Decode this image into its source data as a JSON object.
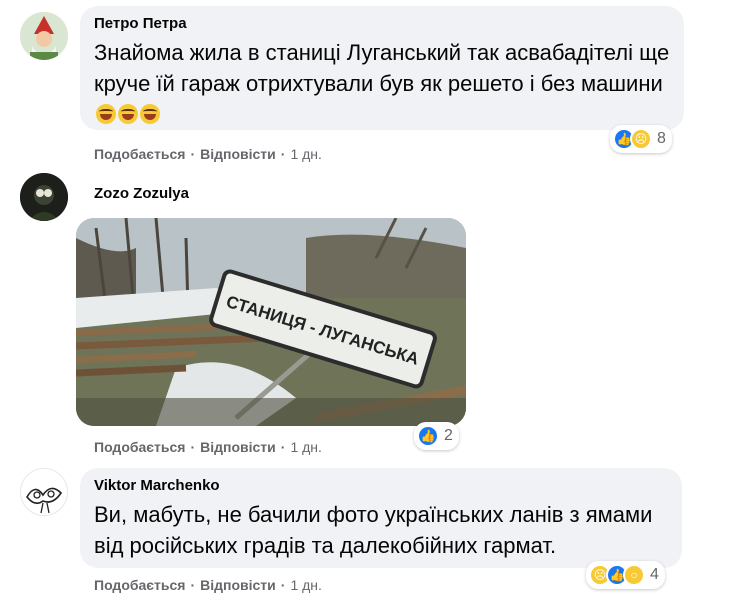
{
  "comments": [
    {
      "author": "Петро Петра",
      "text": "Знайома жила в станиці Луганський так асвабадітелі ще круче їй гараж отрихтували був як решето і без машини",
      "emoji": [
        "laughing-tears-emoji",
        "laughing-tears-emoji",
        "laughing-tears-emoji"
      ],
      "reactions": [
        "like",
        "sad"
      ],
      "reaction_count": "8",
      "like_label": "Подобається",
      "reply_label": "Відповісти",
      "time": "1 дн."
    },
    {
      "author": "Zozo Zozulya",
      "photo_sign_text": "СТАНИЦЯ - ЛУГАНСЬКА",
      "reactions": [
        "like"
      ],
      "reaction_count": "2",
      "like_label": "Подобається",
      "reply_label": "Відповісти",
      "time": "1 дн."
    },
    {
      "author": "Viktor Marchenko",
      "text": "Ви, мабуть, не бачили фото українських ланів з ямами від російських градів та далекобійних гармат.",
      "reactions": [
        "sad",
        "like",
        "wow"
      ],
      "reaction_count": "4",
      "like_label": "Подобається",
      "reply_label": "Відповісти",
      "time": "1 дн."
    }
  ],
  "separator": "·",
  "colors": {
    "bubble": "#f0f2f5",
    "meta_text": "#65676b",
    "like_blue": "#1877f2",
    "reaction_yellow": "#f7c934"
  }
}
